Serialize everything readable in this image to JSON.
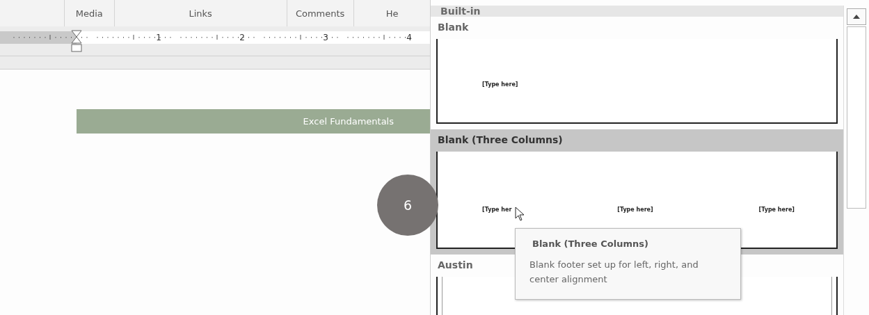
{
  "ribbon_groups": [
    {
      "label": "Media"
    },
    {
      "label": "Links"
    },
    {
      "label": "Comments"
    },
    {
      "label": "He"
    }
  ],
  "ruler": {
    "numbers": [
      "1",
      "2",
      "3",
      "4"
    ]
  },
  "document": {
    "banner": "Excel Fundamentals"
  },
  "step_badge": "6",
  "gallery": {
    "section": "Built-in",
    "items": [
      {
        "name": "Blank",
        "kind": "blank",
        "selected": false,
        "placeholders": [
          "[Type here]"
        ]
      },
      {
        "name": "Blank (Three Columns)",
        "kind": "three-columns",
        "selected": true,
        "placeholders": [
          "[Type her",
          "[Type here]",
          "[Type here]"
        ]
      },
      {
        "name": "Austin",
        "kind": "austin",
        "selected": false
      }
    ]
  },
  "tooltip": {
    "title": "Blank (Three Columns)",
    "description": "Blank footer set up for left, right, and center alignment"
  }
}
